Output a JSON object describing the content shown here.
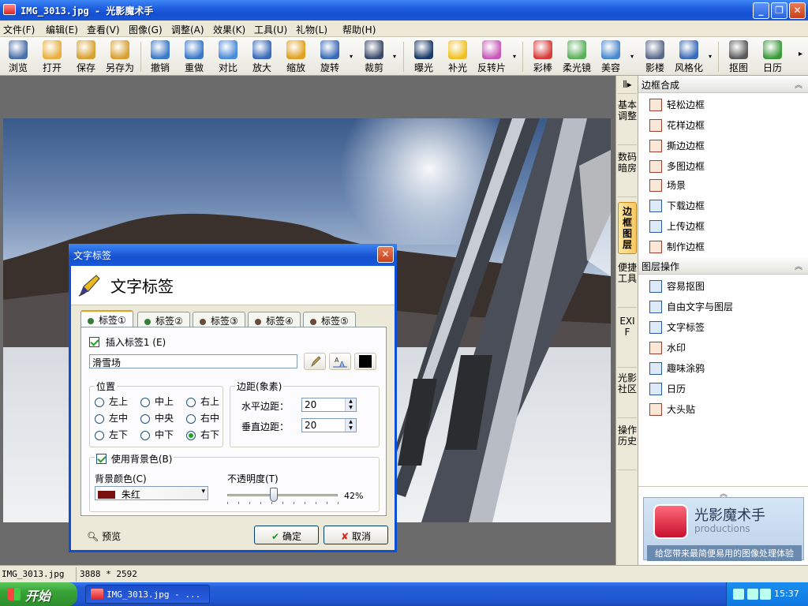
{
  "window": {
    "title": "IMG_3013.jpg - 光影魔术手",
    "minimize": "_",
    "restore": "❐",
    "close": "✕"
  },
  "menu": [
    "文件(F)",
    "编辑(E)",
    "查看(V)",
    "图像(G)",
    "调整(A)",
    "效果(K)",
    "工具(U)",
    "礼物(L)",
    "帮助(H)"
  ],
  "toolbar": {
    "items": [
      {
        "label": "浏览",
        "color": "#4a6ea8"
      },
      {
        "label": "打开",
        "color": "#e8b040"
      },
      {
        "label": "保存",
        "color": "#d8a030"
      },
      {
        "label": "另存为",
        "color": "#d8a030"
      },
      {
        "label": "撤销",
        "color": "#3a78c8"
      },
      {
        "label": "重做",
        "color": "#3a78c8"
      },
      {
        "label": "对比",
        "color": "#4a8ad8"
      },
      {
        "label": "放大",
        "color": "#3a6ab8"
      },
      {
        "label": "缩放",
        "color": "#e0a020"
      },
      {
        "label": "旋转",
        "color": "#3a6ab8"
      },
      {
        "label": "裁剪",
        "color": "#3a4a6a"
      },
      {
        "label": "曝光",
        "color": "#1a3a6a"
      },
      {
        "label": "补光",
        "color": "#f0c020"
      },
      {
        "label": "反转片",
        "color": "#c858b8"
      },
      {
        "label": "彩棒",
        "color": "#d83a3a"
      },
      {
        "label": "柔光镜",
        "color": "#5ab05a"
      },
      {
        "label": "美容",
        "color": "#4a88d0"
      },
      {
        "label": "影楼",
        "color": "#5a6a8a"
      },
      {
        "label": "风格化",
        "color": "#3a6ab8"
      },
      {
        "label": "抠图",
        "color": "#5a5a5a"
      },
      {
        "label": "日历",
        "color": "#3a9a3a"
      }
    ],
    "more": "▸"
  },
  "vtabs": [
    "基本调整",
    "数码暗房",
    "边框图层",
    "便捷工具",
    "EXIF",
    "光影社区",
    "操作历史"
  ],
  "vtabs_toggle": "⦀▸",
  "panel": {
    "section1": {
      "title": "边框合成",
      "items": [
        "轻松边框",
        "花样边框",
        "撕边边框",
        "多图边框",
        "场景",
        "下载边框",
        "上传边框",
        "制作边框"
      ]
    },
    "section2": {
      "title": "图层操作",
      "items": [
        "容易抠图",
        "自由文字与图层",
        "文字标签",
        "水印",
        "趣味涂鸦",
        "日历",
        "大头贴"
      ]
    },
    "collapse_icon": "︽",
    "ad": {
      "brand": "光影魔术手",
      "sub": "productions",
      "slogan": "给您带来最简便易用的图像处理体验"
    }
  },
  "dialog": {
    "title": "文字标签",
    "header": "文字标签",
    "close": "✕",
    "tabs": [
      "标签①",
      "标签②",
      "标签③",
      "标签④",
      "标签⑤"
    ],
    "insert_label": "插入标签1 (E)",
    "text_value": "滑雪场",
    "position": {
      "title": "位置",
      "options": [
        "左上",
        "中上",
        "右上",
        "左中",
        "中央",
        "右中",
        "左下",
        "中下",
        "右下"
      ],
      "selected": "右下"
    },
    "margin": {
      "title": "边距(象素)",
      "h_label": "水平边距：",
      "h_value": "20",
      "v_label": "垂直边距：",
      "v_value": "20"
    },
    "use_bg": "使用背景色(B)",
    "bg_color_label": "背景颜色(C)",
    "bg_color_value": "朱红",
    "bg_color_hex": "#7a1010",
    "opacity_label": "不透明度(T)",
    "opacity_value": "42%",
    "opacity_fraction": 0.42,
    "preview": "预览",
    "ok": "确定",
    "cancel": "取消"
  },
  "status": {
    "file": "IMG_3013.jpg",
    "size": "3888 * 2592"
  },
  "taskbar": {
    "start": "开始",
    "item": "IMG_3013.jpg - ...",
    "clock": "15:37"
  }
}
